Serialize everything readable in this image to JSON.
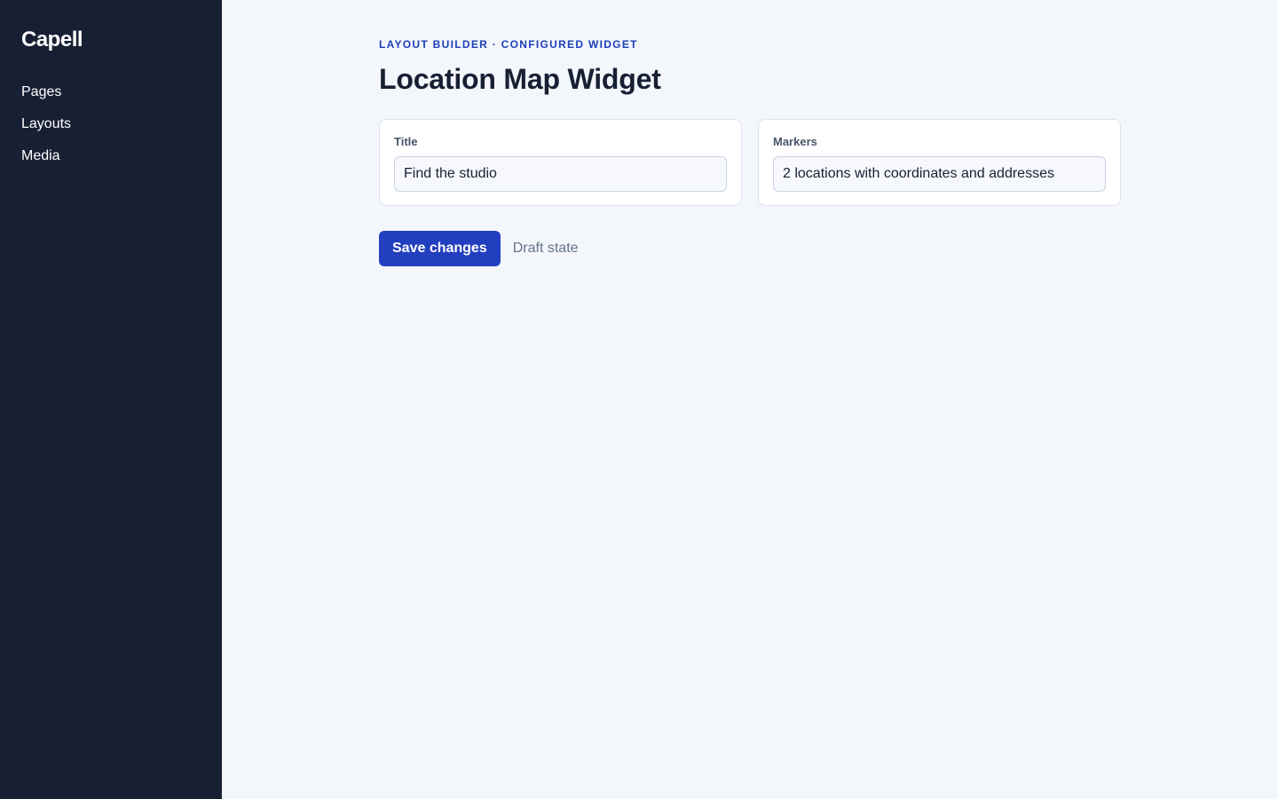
{
  "app": {
    "brand": "Capell"
  },
  "sidebar": {
    "items": [
      {
        "label": "Pages"
      },
      {
        "label": "Layouts"
      },
      {
        "label": "Media"
      }
    ]
  },
  "header": {
    "eyebrow": "LAYOUT BUILDER · CONFIGURED WIDGET",
    "title": "Location Map Widget"
  },
  "form": {
    "title_field": {
      "label": "Title",
      "value": "Find the studio"
    },
    "markers_field": {
      "label": "Markers",
      "value": "2 locations with coordinates and addresses"
    }
  },
  "actions": {
    "save_label": "Save changes",
    "status": "Draft state"
  },
  "colors": {
    "sidebar_bg": "#172033",
    "page_bg": "#f3f6fb",
    "accent": "#223fbf",
    "eyebrow": "#1d3fb8"
  }
}
